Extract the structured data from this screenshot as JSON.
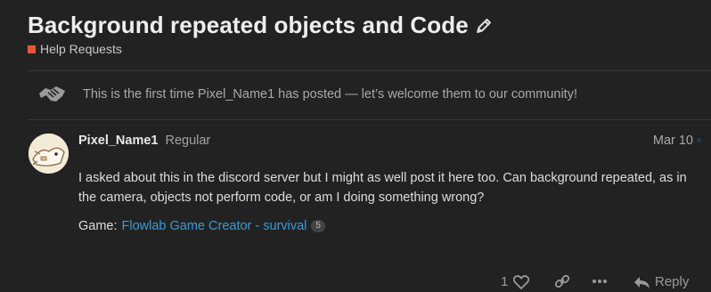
{
  "topic": {
    "title": "Background repeated objects and Code",
    "category": "Help Requests",
    "category_color": "#e45735"
  },
  "welcome_notice": {
    "text": "This is the first time Pixel_Name1 has posted — let’s welcome them to our community!",
    "icon": "handshake-icon"
  },
  "post": {
    "username": "Pixel_Name1",
    "user_title": "Regular",
    "date": "Mar 10",
    "body": "I asked about this in the discord server but I might as well post it here too. Can background repeated, as in the camera, objects not perform code, or am I doing something wrong?",
    "game_label": "Game:",
    "game_link": "Flowlab Game Creator - survival",
    "link_clicks": "5"
  },
  "actions": {
    "like_count": "1",
    "reply_label": "Reply"
  },
  "colors": {
    "background": "#222222",
    "link": "#3a9ad9",
    "text": "#dddddd",
    "muted": "#a9a9a9"
  }
}
